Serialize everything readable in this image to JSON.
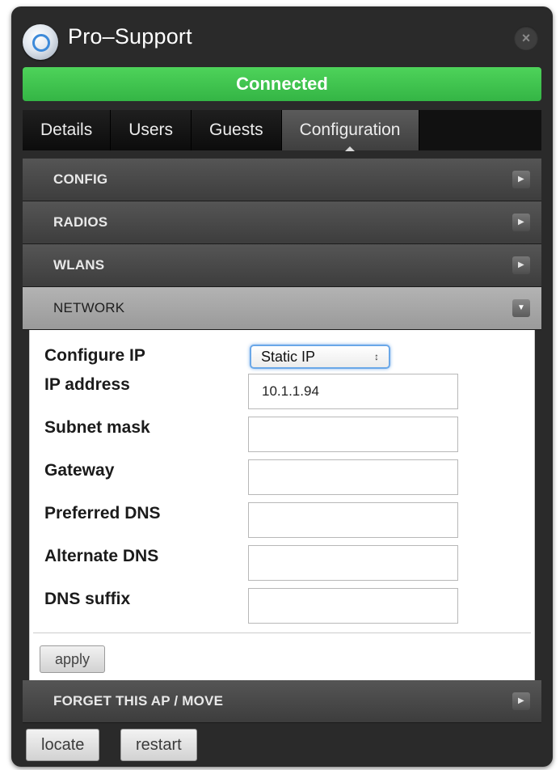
{
  "window": {
    "title": "Pro–Support",
    "status": "Connected",
    "accent_color": "#3cc24e"
  },
  "tabs": [
    {
      "label": "Details",
      "active": false
    },
    {
      "label": "Users",
      "active": false
    },
    {
      "label": "Guests",
      "active": false
    },
    {
      "label": "Configuration",
      "active": true
    }
  ],
  "sections": {
    "config": "CONFIG",
    "radios": "RADIOS",
    "wlans": "WLANS",
    "network": "NETWORK",
    "forget": "FORGET THIS AP / MOVE"
  },
  "network": {
    "configure_ip_label": "Configure IP",
    "configure_ip_value": "Static IP",
    "ip_address_label": "IP address",
    "ip_address_value": "10.1.1.94",
    "subnet_mask_label": "Subnet mask",
    "subnet_mask_value": "",
    "gateway_label": "Gateway",
    "gateway_value": "",
    "preferred_dns_label": "Preferred DNS",
    "preferred_dns_value": "",
    "alternate_dns_label": "Alternate DNS",
    "alternate_dns_value": "",
    "dns_suffix_label": "DNS suffix",
    "dns_suffix_value": "",
    "apply_label": "apply"
  },
  "footer": {
    "locate_label": "locate",
    "restart_label": "restart"
  },
  "icons": {
    "arrow_collapsed": "▶",
    "arrow_expanded": "▼",
    "close": "×",
    "select_arrows": "↕"
  }
}
